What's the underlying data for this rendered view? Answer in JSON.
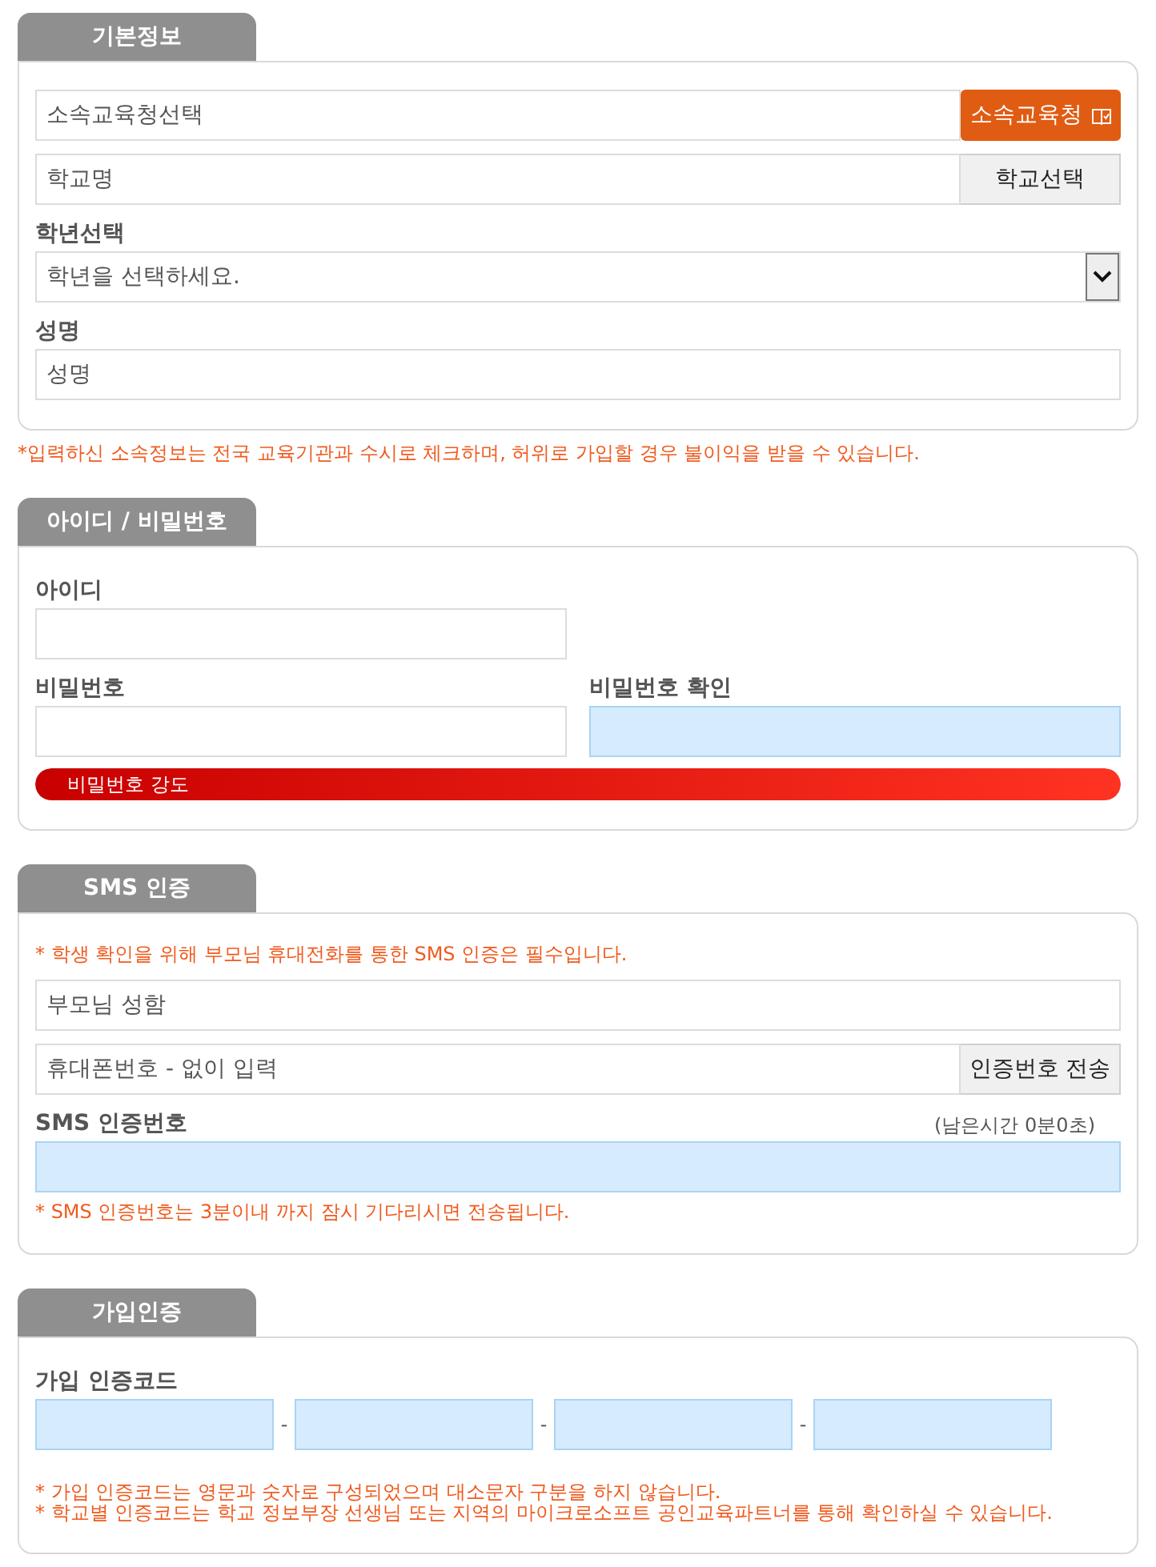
{
  "sections": [
    {
      "title": "기본정보",
      "rows": [
        {
          "kind": "input-button",
          "field": {
            "placeholder": "소속교육청선택",
            "highlighted": false
          },
          "button": {
            "label": "소속교육청",
            "kind": "primary"
          }
        },
        {
          "kind": "input-button",
          "field": {
            "placeholder": "학교명",
            "highlighted": false
          },
          "button": {
            "label": "학교선택",
            "kind": "secondary"
          }
        },
        {
          "kind": "label",
          "label": "학년선택"
        },
        {
          "kind": "select",
          "value": "학년을 선택하세요."
        },
        {
          "kind": "label",
          "label": "성명"
        },
        {
          "kind": "input",
          "field": {
            "placeholder": "성명",
            "highlighted": false
          }
        }
      ],
      "footnote": "*입력하신 소속정보는 전국 교육기관과 수시로 체크하며, 허위로 가입할 경우 불이익을 받을 수 있습니다."
    },
    {
      "title": "아이디 / 비밀번호",
      "rows": [
        {
          "kind": "pair",
          "columns": [
            {
              "label": "아이디",
              "field": {
                "highlighted": false
              }
            }
          ]
        },
        {
          "kind": "pair",
          "columns": [
            {
              "label": "비밀번호",
              "field": {
                "highlighted": false
              }
            },
            {
              "label": "비밀번호 확인",
              "field": {
                "highlighted": true
              }
            }
          ]
        },
        {
          "kind": "meter",
          "label": "비밀번호 강도",
          "level": 1
        }
      ]
    },
    {
      "title": "SMS 인증",
      "rows": [
        {
          "kind": "note",
          "text": "* 학생 확인을 위해 부모님 휴대전화를 통한 SMS 인증은 필수입니다."
        },
        {
          "kind": "input",
          "field": {
            "placeholder": "부모님 성함",
            "highlighted": false
          }
        },
        {
          "kind": "input-button",
          "field": {
            "placeholder": "휴대폰번호 - 없이 입력",
            "highlighted": false
          },
          "button": {
            "label": "인증번호 전송",
            "kind": "secondary"
          }
        },
        {
          "kind": "label",
          "label": "SMS 인증번호",
          "aside": "(남은시간 0분0초)"
        },
        {
          "kind": "input",
          "field": {
            "highlighted": true
          }
        },
        {
          "kind": "note",
          "text": "* SMS 인증번호는 3분이내 까지 잠시 기다리시면 전송됩니다."
        }
      ]
    },
    {
      "title": "가입인증",
      "rows": [
        {
          "kind": "label",
          "label": "가입 인증코드"
        },
        {
          "kind": "code",
          "fields": [
            {
              "highlighted": true
            },
            {
              "highlighted": true
            },
            {
              "highlighted": true
            },
            {
              "highlighted": true
            }
          ],
          "separators": [
            "-",
            "-",
            "-"
          ]
        },
        {
          "kind": "notes",
          "lines": [
            "* 가입 인증코드는 영문과 숫자로 구성되었으며 대소문자 구분을 하지 않습니다.",
            "* 학교별 인증코드는 학교 정보부장 선생님 또는 지역의 마이크로소프트 공인교육파트너를 통해 확인하실 수 있습니다."
          ]
        }
      ]
    }
  ]
}
